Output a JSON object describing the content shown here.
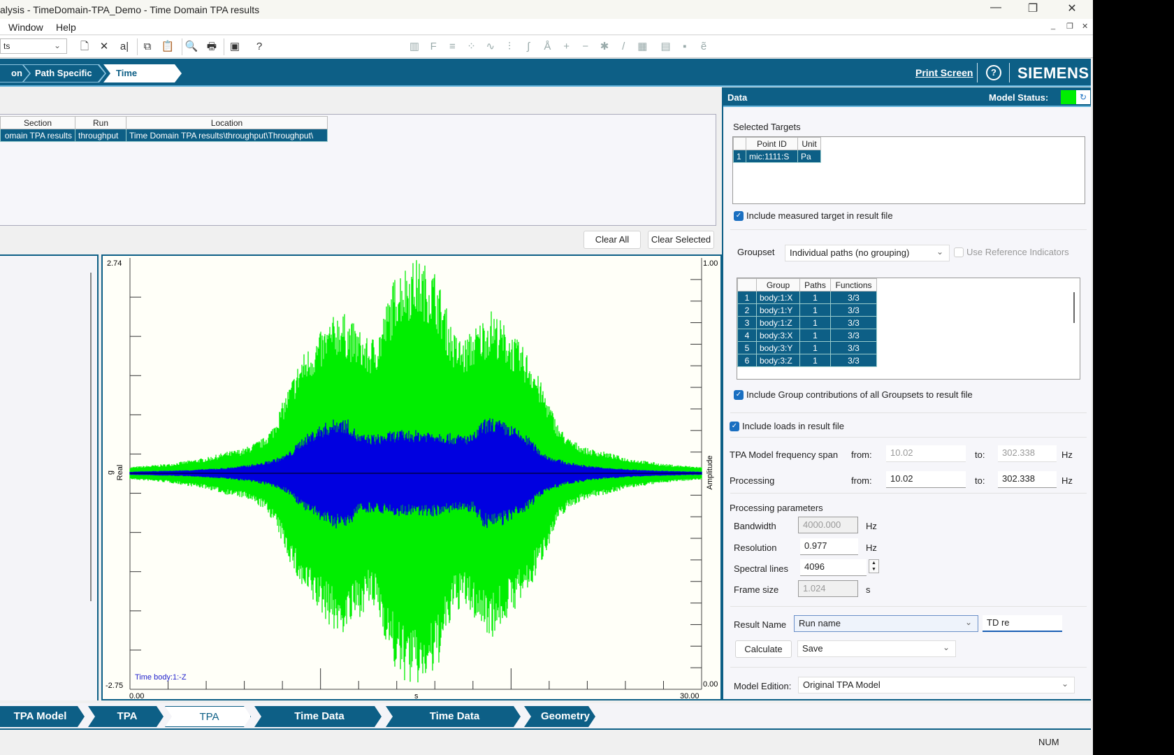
{
  "window": {
    "title": "alysis - TimeDomain-TPA_Demo - Time Domain TPA results",
    "minimize": "—",
    "restore": "❐",
    "close": "✕"
  },
  "menu": {
    "items": [
      "Window",
      "Help"
    ],
    "mdi": [
      "_",
      "❐",
      "✕"
    ]
  },
  "toolbar": {
    "dropdown_value": "ts",
    "icons": [
      "new-document-icon",
      "delete-icon",
      "rename-icon",
      "copy-icon",
      "paste-icon",
      "print-preview-icon",
      "print-icon",
      "export-icon",
      "help-icon"
    ],
    "glyphs": [
      "🗋",
      "✕",
      "a|",
      "⧉",
      "📋",
      "🔍",
      "🖶",
      "▣",
      "?"
    ],
    "graph_icons": [
      "fft-icon",
      "frf-icon",
      "filter-icon",
      "scatter-icon",
      "waveform-icon",
      "derivative-icon",
      "integral-icon",
      "a-weighting-icon",
      "add-icon",
      "subtract-icon",
      "multiply-icon",
      "divide-icon",
      "spectrum-icon",
      "list-icon",
      "save-icon",
      "exponential-icon"
    ],
    "graph_glyphs": [
      "▥",
      "F",
      "≡",
      "⁘",
      "∿",
      "⫶",
      "∫",
      "Å",
      "+",
      "−",
      "✱",
      "/",
      "▦",
      "▤",
      "▪",
      "ẽ"
    ]
  },
  "breadcrumb": [
    {
      "label": "on"
    },
    {
      "label": "Path Specific"
    },
    {
      "label": "Time Domain",
      "selected": true
    }
  ],
  "header": {
    "print_screen": "Print Screen",
    "help": "?",
    "brand": "SIEMENS"
  },
  "results_table": {
    "columns": [
      "Section",
      "Run",
      "Location"
    ],
    "rows": [
      [
        "omain TPA results",
        "throughput",
        "Time Domain TPA results\\throughput\\Throughput\\"
      ]
    ]
  },
  "buttons": {
    "clear_all": "Clear All",
    "clear_selected": "Clear Selected"
  },
  "chart_data": {
    "type": "area",
    "x_range": [
      0,
      30
    ],
    "y_range": [
      -2.75,
      2.74
    ],
    "right_axis_range": [
      0,
      1
    ],
    "x_tick_labels": [
      "0.00",
      "30.00"
    ],
    "y_tick_labels": [
      "2.74",
      "-2.75"
    ],
    "right_tick_labels": [
      "1.00",
      "0.00"
    ],
    "xlabel": "s",
    "ylabel_unit": "g",
    "ylabel": "Real",
    "right_label": "Amplitude",
    "legend": "Time body:1:-Z",
    "series": [
      {
        "color": "#00ee00",
        "envelope_x": [
          0,
          2,
          4,
          5,
          6,
          7,
          7.5,
          8,
          8.5,
          9,
          10,
          11,
          12,
          12.5,
          13,
          14,
          15,
          16,
          17,
          17.5,
          18,
          19,
          20,
          21,
          21.5,
          22,
          22.5,
          23,
          24,
          25,
          26,
          28,
          30
        ],
        "envelope_y": [
          0.08,
          0.12,
          0.2,
          0.27,
          0.32,
          0.45,
          0.6,
          0.9,
          1.2,
          1.5,
          1.8,
          2.1,
          1.85,
          1.7,
          1.8,
          2.6,
          2.74,
          2.6,
          1.8,
          1.7,
          1.85,
          2.1,
          1.8,
          1.5,
          1.2,
          0.9,
          0.6,
          0.45,
          0.32,
          0.27,
          0.2,
          0.12,
          0.08
        ]
      },
      {
        "color": "#0000e0",
        "envelope_x": [
          0,
          3,
          5,
          6,
          7,
          8,
          8.5,
          9,
          10,
          11,
          11.5,
          12,
          13,
          14,
          15,
          16,
          17,
          18,
          18.5,
          19,
          20,
          21,
          21.5,
          22,
          23,
          24,
          25,
          27,
          30
        ],
        "envelope_y": [
          0.02,
          0.04,
          0.07,
          0.1,
          0.14,
          0.22,
          0.3,
          0.45,
          0.62,
          0.72,
          0.68,
          0.5,
          0.5,
          0.55,
          0.55,
          0.55,
          0.5,
          0.5,
          0.68,
          0.72,
          0.62,
          0.45,
          0.3,
          0.22,
          0.14,
          0.1,
          0.07,
          0.04,
          0.02
        ]
      }
    ],
    "grid": false
  },
  "data_panel": {
    "title": "Data",
    "model_status_label": "Model Status:",
    "model_status_color": "#00ee00",
    "selected_targets_label": "Selected Targets",
    "targets": {
      "columns": [
        "",
        "Point ID",
        "Unit"
      ],
      "rows": [
        [
          "1",
          "mic:1111:S",
          "Pa"
        ]
      ]
    },
    "include_measured": {
      "label": "Include measured target in result file",
      "checked": true
    },
    "groupset_label": "Groupset",
    "groupset_value": "Individual paths (no grouping)",
    "use_reference": {
      "label": "Use Reference Indicators",
      "checked": false
    },
    "groups": {
      "columns": [
        "",
        "Group",
        "Paths",
        "Functions"
      ],
      "rows": [
        [
          "1",
          "body:1:X",
          "1",
          "3/3"
        ],
        [
          "2",
          "body:1:Y",
          "1",
          "3/3"
        ],
        [
          "3",
          "body:1:Z",
          "1",
          "3/3"
        ],
        [
          "4",
          "body:3:X",
          "1",
          "3/3"
        ],
        [
          "5",
          "body:3:Y",
          "1",
          "3/3"
        ],
        [
          "6",
          "body:3:Z",
          "1",
          "3/3"
        ]
      ]
    },
    "include_group": {
      "label": "Include Group contributions of all Groupsets to result file",
      "checked": true
    },
    "include_loads": {
      "label": "Include loads in result file",
      "checked": true
    },
    "freq_span": {
      "label": "TPA Model frequency span",
      "from_label": "from:",
      "from": "10.02",
      "to_label": "to:",
      "to": "302.338",
      "unit": "Hz"
    },
    "processing": {
      "label": "Processing",
      "from_label": "from:",
      "from": "10.02",
      "to_label": "to:",
      "to": "302.338",
      "unit": "Hz"
    },
    "params": {
      "label": "Processing parameters",
      "bandwidth": {
        "label": "Bandwidth",
        "value": "4000.000",
        "unit": "Hz"
      },
      "resolution": {
        "label": "Resolution",
        "value": "0.977",
        "unit": "Hz"
      },
      "spectral_lines": {
        "label": "Spectral lines",
        "value": "4096"
      },
      "frame_size": {
        "label": "Frame size",
        "value": "1.024",
        "unit": "s"
      }
    },
    "result_name": {
      "label": "Result Name",
      "mode": "Run name",
      "value": "TD re"
    },
    "calculate": "Calculate",
    "save_mode": "Save",
    "model_edition": {
      "label": "Model Edition:",
      "value": "Original TPA Model"
    }
  },
  "bottom_tabs": [
    {
      "label": "TPA Model"
    },
    {
      "label": "TPA Loads"
    },
    {
      "label": "TPA Results",
      "selected": true
    },
    {
      "label": "Time Data Selection"
    },
    {
      "label": "Time Data Processing"
    },
    {
      "label": "Geometry"
    }
  ],
  "status": {
    "num": "NUM"
  }
}
